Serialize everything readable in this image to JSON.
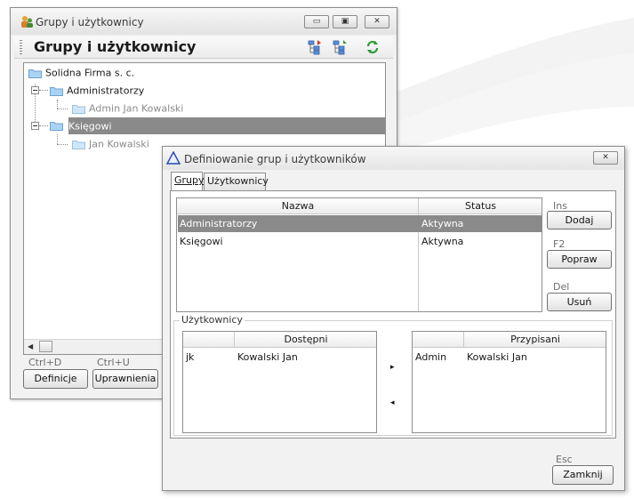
{
  "main_window": {
    "title": "Grupy i użytkownicy",
    "header_title": "Grupy i użytkownicy",
    "controls": {
      "minimize": "▭",
      "maximize": "▣",
      "close": "✕"
    },
    "tree": [
      {
        "label": "Solidna Firma s. c."
      },
      {
        "label": "Administratorzy"
      },
      {
        "label": "Admin Jan Kowalski"
      },
      {
        "label": "Księgowi"
      },
      {
        "label": "Jan  Kowalski"
      }
    ],
    "shortcuts": {
      "definicje": "Ctrl+D",
      "uprawnienia": "Ctrl+U"
    },
    "buttons": {
      "definicje": "Definicje",
      "uprawnienia": "Uprawnienia"
    }
  },
  "dialog": {
    "title": "Definiowanie grup i użytkowników",
    "close": "✕",
    "tabs": [
      "Grupy",
      "Użytkownicy"
    ],
    "groups_table": {
      "columns": [
        "Nazwa",
        "Status"
      ],
      "rows": [
        {
          "nazwa": "Administratorzy",
          "status": "Aktywna"
        },
        {
          "nazwa": "Księgowi",
          "status": "Aktywna"
        }
      ]
    },
    "side_buttons": [
      {
        "shortcut": "Ins",
        "label": "Dodaj"
      },
      {
        "shortcut": "F2",
        "label": "Popraw"
      },
      {
        "shortcut": "Del",
        "label": "Usuń"
      }
    ],
    "users_group_label": "Użytkownicy",
    "available": {
      "columns": [
        "",
        "Dostępni"
      ],
      "rows": [
        {
          "login": "jk",
          "name": "Kowalski Jan"
        }
      ]
    },
    "assigned": {
      "columns": [
        "",
        "Przypisani"
      ],
      "rows": [
        {
          "login": "Admin",
          "name": "Kowalski Jan"
        }
      ]
    },
    "move_right": "▸",
    "move_left": "◂",
    "close_shortcut": "Esc",
    "close_label": "Zamknij"
  },
  "colors": {
    "selection": "#8a8a8a",
    "window_bg": "#f2f2f2",
    "folder": "#a9d3f5"
  }
}
